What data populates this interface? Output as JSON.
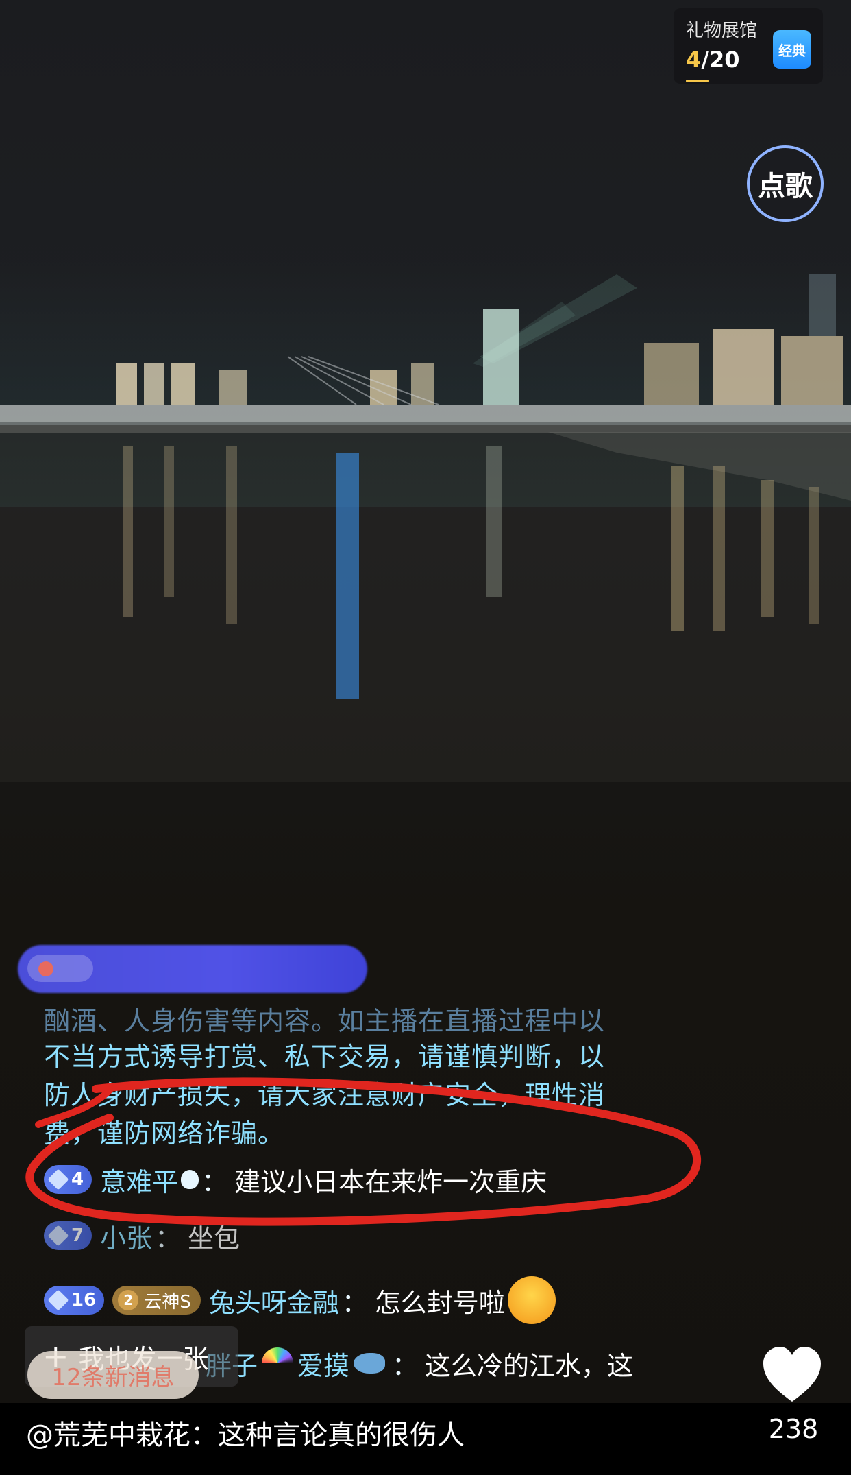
{
  "gift_hall": {
    "title": "礼物展馆",
    "count_current": "4",
    "count_total": "/20",
    "tag": "经典"
  },
  "song_request": {
    "label": "点歌"
  },
  "chat": {
    "system_notice_lines": [
      "酗酒、人身伤害等内容。如主播在直播过程中以",
      "不当方式诱导打赏、私下交易，请谨慎判断，以",
      "防人身财产损失，请大家注意财产安全，理性消",
      "费，谨防网络诈骗。"
    ],
    "messages": [
      {
        "level": "4",
        "name": "意难平",
        "text": "建议小日本在来炸一次重庆"
      },
      {
        "level": "7",
        "name": "小张",
        "text": "坐包"
      },
      {
        "level": "16",
        "fan_level": "2",
        "fan_club": "云神S",
        "name": "兔头呀金融",
        "text": "怎么封号啦"
      },
      {
        "name_prefix": "胖子",
        "name": "爱摸",
        "text": "这么冷的江水，这"
      }
    ]
  },
  "compose": {
    "plus": "+",
    "label": "我也发一张"
  },
  "new_messages": {
    "label": "12条新消息"
  },
  "likes": {
    "count": "238"
  },
  "caption": {
    "text": "@荒芜中栽花：这种言论真的很伤人"
  },
  "colors": {
    "accent_blue": "#8fe0ff",
    "gift_gold": "#f7c74a",
    "annotation_red": "#e0261f",
    "badge_blue": "#4562d8"
  }
}
